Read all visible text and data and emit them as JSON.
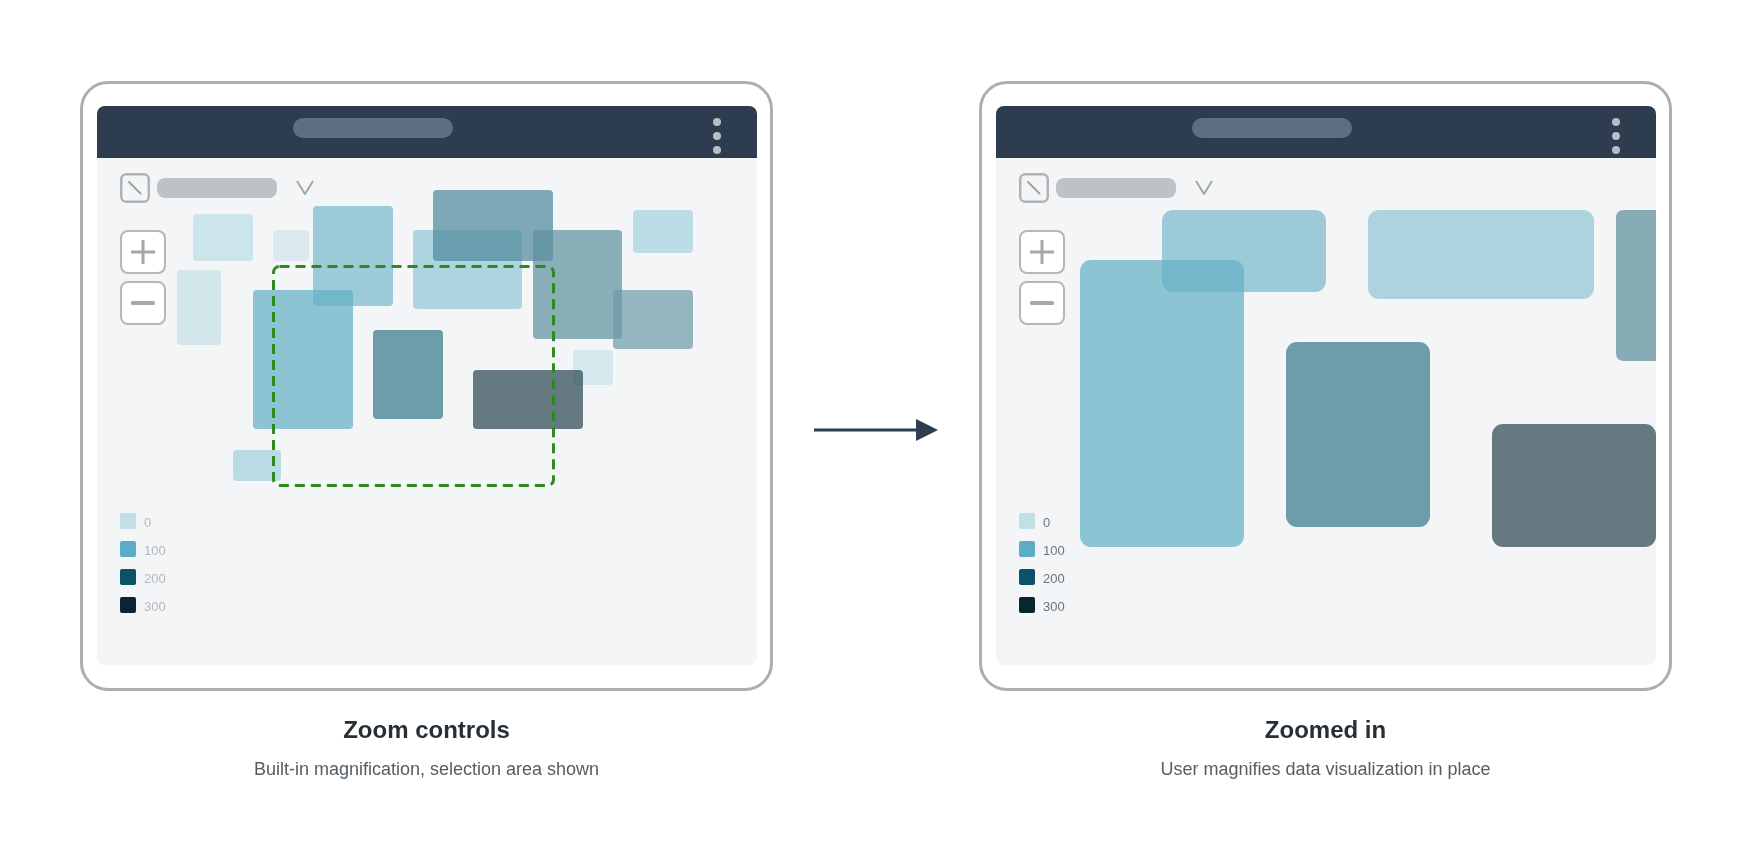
{
  "panels": [
    {
      "kind": "overview",
      "selection_shown": true,
      "legend": {
        "dimmed": true,
        "items": [
          {
            "label": "0",
            "color": "#c0dfe7"
          },
          {
            "label": "100",
            "color": "#5aadc4"
          },
          {
            "label": "200",
            "color": "#0b5168"
          },
          {
            "label": "300",
            "color": "#0a2430"
          }
        ]
      },
      "caption": {
        "title": "Zoom controls",
        "subtitle": "Built-in magnification, selection area shown"
      }
    },
    {
      "kind": "zoomed",
      "selection_shown": false,
      "legend": {
        "dimmed": false,
        "items": [
          {
            "label": "0",
            "color": "#c0dfe7"
          },
          {
            "label": "100",
            "color": "#5aadc4"
          },
          {
            "label": "200",
            "color": "#0b5168"
          },
          {
            "label": "300",
            "color": "#0a2430"
          }
        ]
      },
      "caption": {
        "title": "Zoomed in",
        "subtitle": "User magnifies data visualization in place"
      }
    }
  ]
}
